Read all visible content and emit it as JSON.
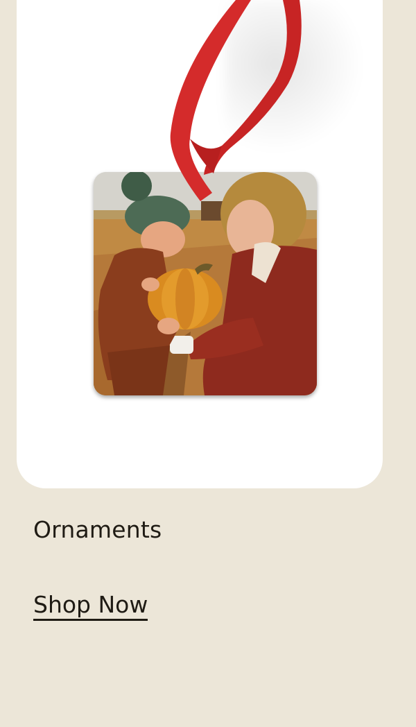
{
  "product": {
    "image_alt": "Square photo ornament with red ribbon showing a child and woman holding a pumpkin",
    "title": "Ornaments",
    "cta_label": "Shop Now"
  },
  "colors": {
    "page_background": "#ECE6D8",
    "card_background": "#FFFFFF",
    "ribbon": "#D42B2B",
    "text": "#1F1B14"
  }
}
